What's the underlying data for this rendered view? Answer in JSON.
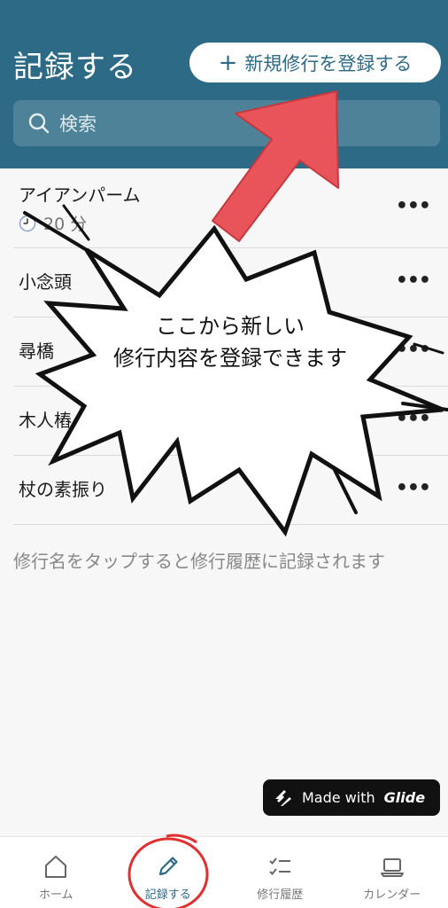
{
  "header": {
    "title": "記録する",
    "new_button_icon": "plus-icon",
    "new_button_label": "新規修行を登録する",
    "search_placeholder": "検索"
  },
  "list": {
    "items": [
      {
        "name": "アイアンパーム",
        "duration": "20 分",
        "duration_icon": "clock-icon",
        "more": "•••"
      },
      {
        "name": "小念頭",
        "more": "•••"
      },
      {
        "name": "尋橋",
        "more": "•••"
      },
      {
        "name": "木人樁",
        "more": "•••"
      },
      {
        "name": "杖の素振り",
        "more": "•••"
      }
    ],
    "hint": "修行名をタップすると修行履歴に記録されます"
  },
  "callout": {
    "text_line1": "ここから新しい",
    "text_line2": "修行内容を登録できます"
  },
  "badge": {
    "prefix": "Made with",
    "brand": "Glide"
  },
  "tabbar": {
    "tabs": [
      {
        "label": "ホーム",
        "icon": "home-icon"
      },
      {
        "label": "記録する",
        "icon": "pencil-icon",
        "active": true
      },
      {
        "label": "修行履歴",
        "icon": "checklist-icon"
      },
      {
        "label": "カレンダー",
        "icon": "laptop-icon"
      }
    ]
  },
  "colors": {
    "header_bg": "#2d6a85",
    "arrow": "#e8545a",
    "annotation_circle": "#e03030"
  }
}
